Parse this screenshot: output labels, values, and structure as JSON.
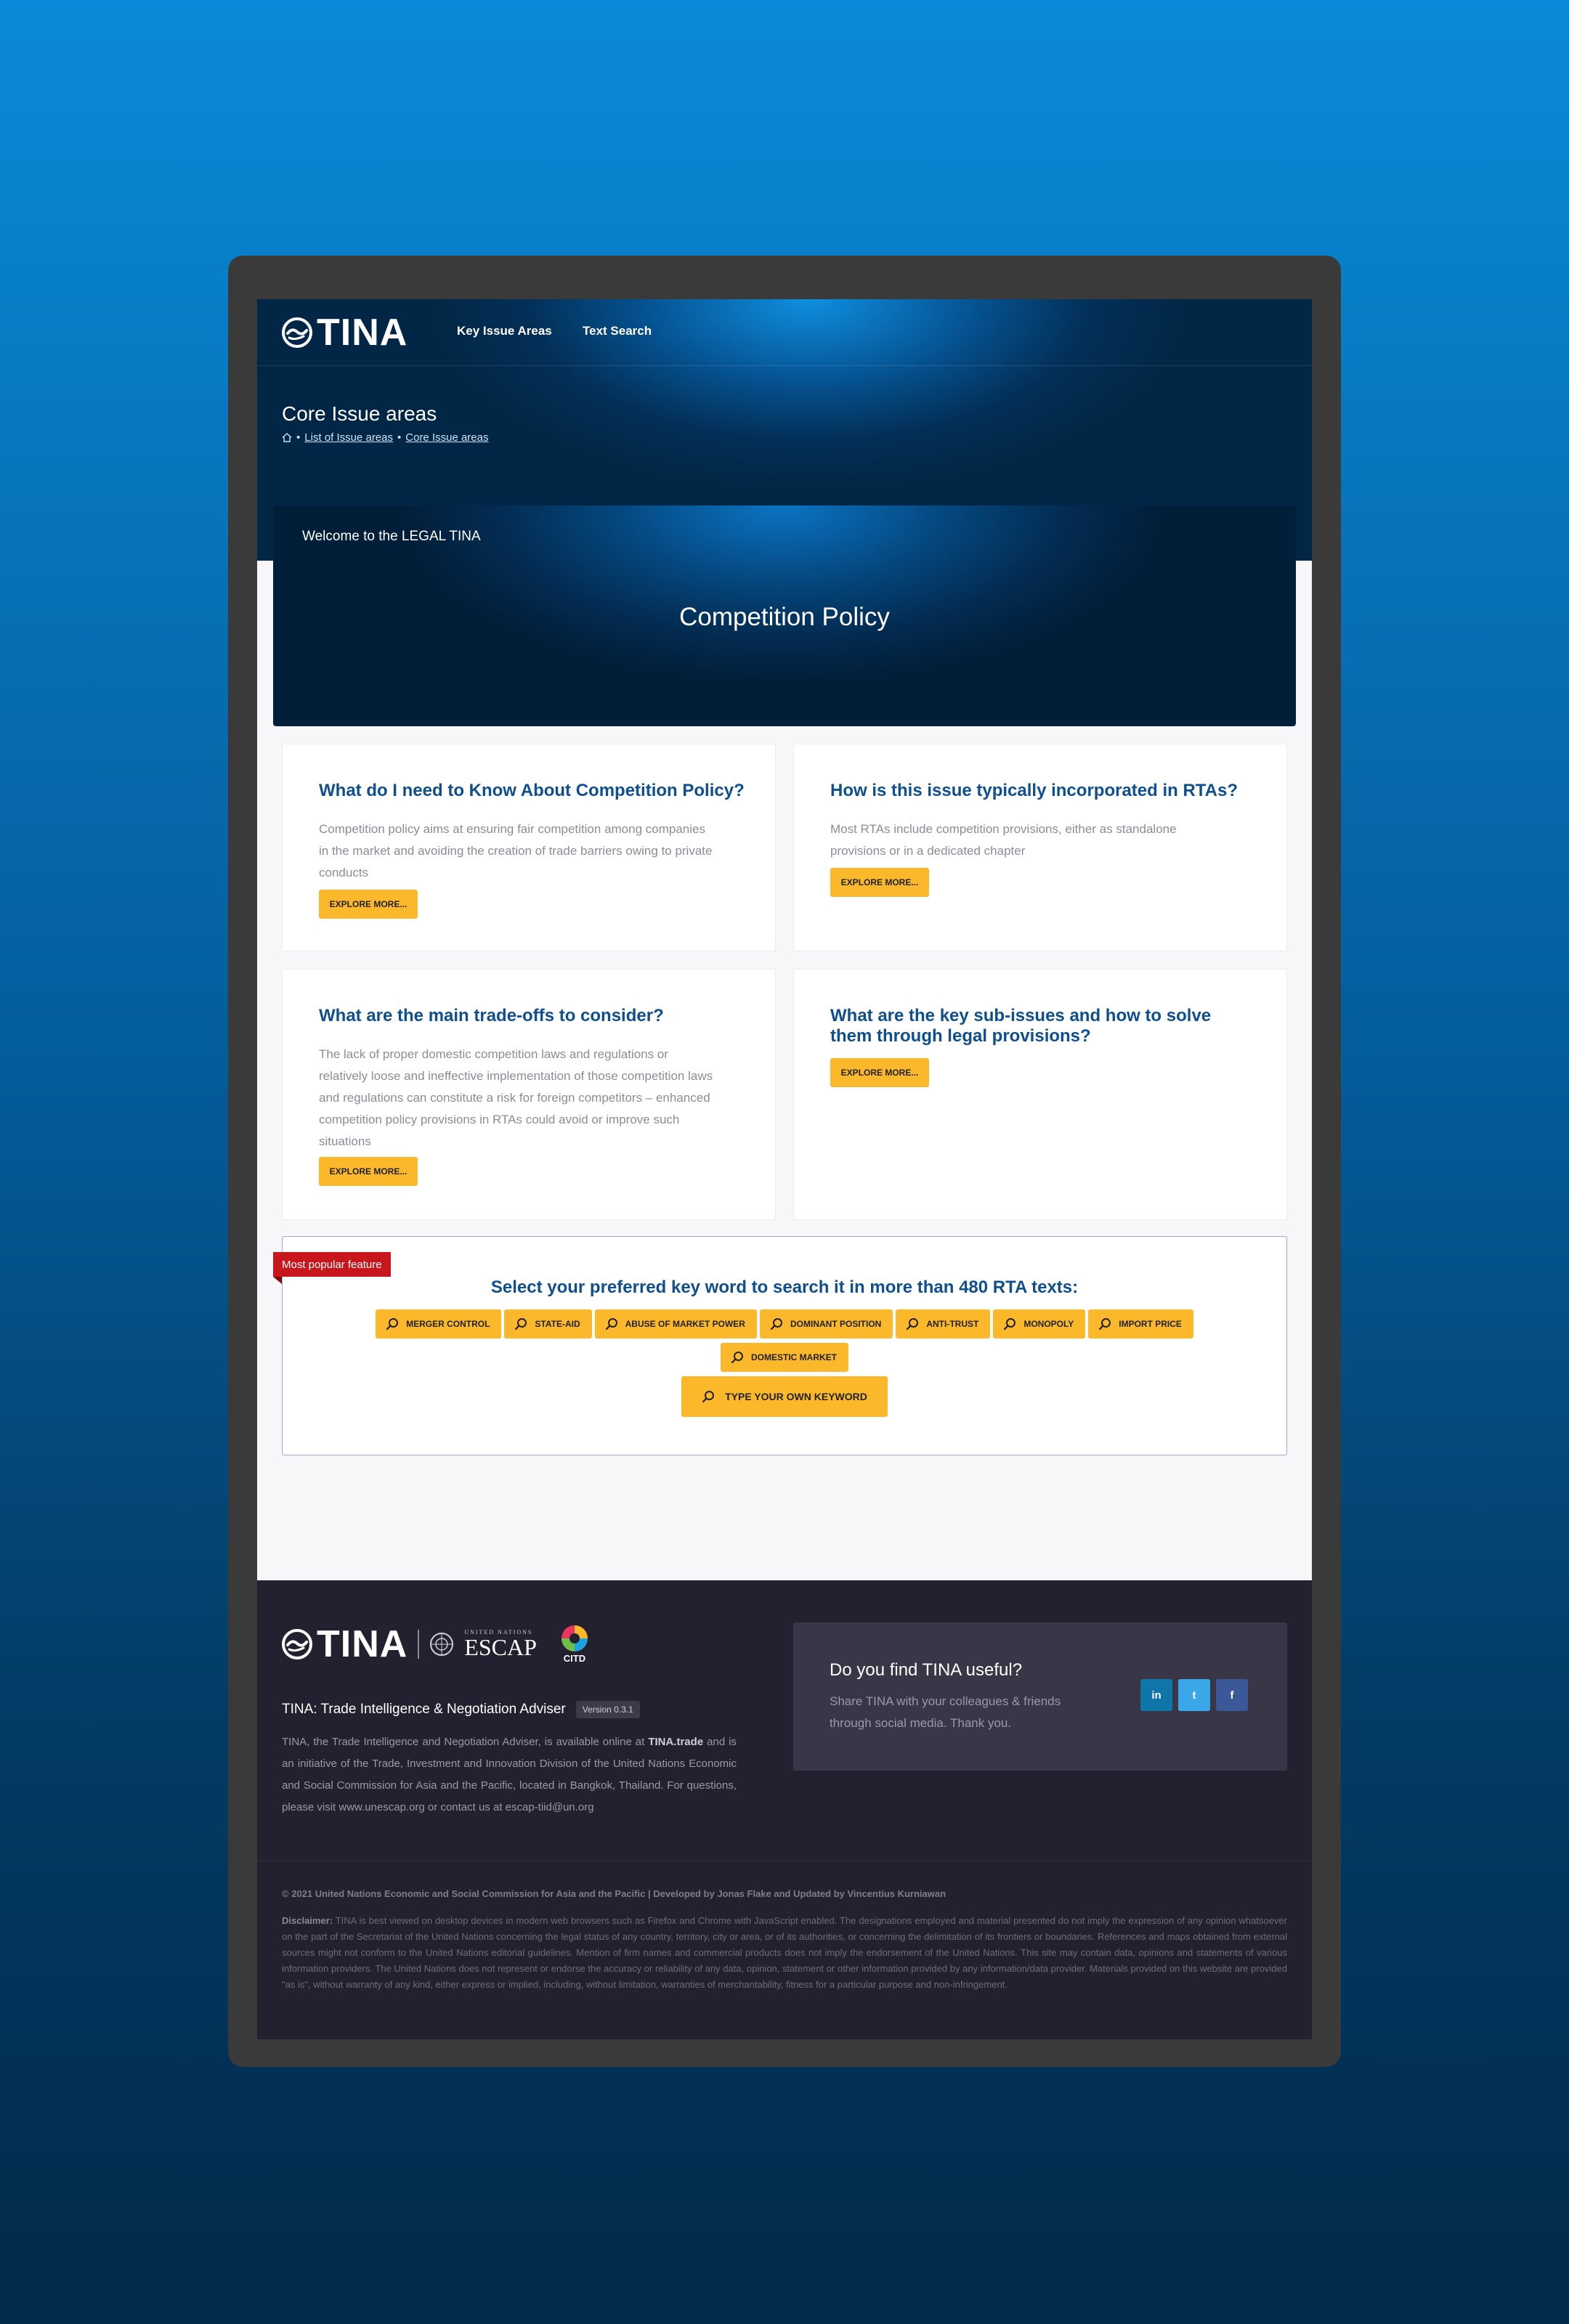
{
  "nav": {
    "logo": "TINA",
    "links": [
      "Key Issue Areas",
      "Text Search"
    ]
  },
  "header": {
    "title": "Core Issue areas",
    "breadcrumbs": [
      "List of Issue areas",
      "Core Issue areas"
    ]
  },
  "banner": {
    "welcome": "Welcome to the LEGAL TINA",
    "headline": "Competition Policy"
  },
  "cards": [
    {
      "title": "What do I need to Know About Competition Policy?",
      "body": "Competition policy aims at ensuring fair competition among companies in the market and avoiding the creation of trade barriers owing to private conducts",
      "button": "EXPLORE MORE..."
    },
    {
      "title": "How is this issue typically incorporated in RTAs?",
      "body": "Most RTAs include competition provisions, either as standalone provisions or in a dedicated chapter",
      "button": "EXPLORE MORE..."
    },
    {
      "title": "What are the main trade-offs to consider?",
      "body": "The lack of proper domestic competition laws and regulations or relatively loose and ineffective implementation of those competition laws and regulations can constitute a risk for foreign competitors – enhanced competition policy provisions in RTAs could avoid or improve such situations",
      "button": "EXPLORE MORE..."
    },
    {
      "title": "What are the key sub-issues and how to solve them through legal provisions?",
      "body": "",
      "button": "EXPLORE MORE..."
    }
  ],
  "keyword_search": {
    "ribbon": "Most popular feature",
    "title": "Select your preferred key word to search it in more than 480 RTA texts:",
    "keywords_row1": [
      "MERGER CONTROL",
      "STATE-AID",
      "ABUSE OF MARKET POWER",
      "DOMINANT POSITION",
      "ANTI-TRUST",
      "MONOPOLY",
      "IMPORT PRICE"
    ],
    "keywords_row2": [
      "DOMESTIC MARKET"
    ],
    "custom_button": "TYPE YOUR OWN KEYWORD",
    "chip_color": "#fbb82b"
  },
  "footer": {
    "logo": "TINA",
    "partner_logos": [
      "UNITED NATIONS",
      "ESCAP",
      "CITD"
    ],
    "tagline": "TINA: Trade Intelligence & Negotiation Adviser",
    "version": "Version 0.3.1",
    "about_pre": "TINA, the Trade Intelligence and Negotiation Adviser, is available online at ",
    "about_link": "TINA.trade",
    "about_post": " and is an initiative of the Trade, Investment and Innovation Division of the United Nations Economic and Social Commission for Asia and the Pacific, located in Bangkok, Thailand. For questions, please visit www.unescap.org or contact us at escap-tiid@un.org",
    "share_title": "Do you find TINA useful?",
    "share_text": "Share TINA with your colleagues & friends through social media. Thank you.",
    "social": [
      {
        "name": "linkedin-icon",
        "glyph": "in",
        "color": "#0e76a8"
      },
      {
        "name": "twitter-icon",
        "glyph": "t",
        "color": "#3aa8e8"
      },
      {
        "name": "facebook-icon",
        "glyph": "f",
        "color": "#3b5998"
      }
    ],
    "copyright": "© 2021 United Nations Economic and Social Commission for Asia and the Pacific | Developed by Jonas Flake and Updated by Vincentius Kurniawan",
    "disclaimer_label": "Disclaimer:",
    "disclaimer": " TINA is best viewed on desktop devices in modern web browsers such as Firefox and Chrome with JavaScript enabled. The designations employed and material presented do not imply the expression of any opinion whatsoever on the part of the Secretariat of the United Nations concerning the legal status of any country, territory, city or area, or of its authorities, or concerning the delimitation of its frontiers or boundaries. References and maps obtained from external sources might not conform to the United Nations editorial guidelines. Mention of firm names and commercial products does not imply the endorsement of the United Nations. This site may contain data, opinions and statements of various information providers. The United Nations does not represent or endorse the accuracy or reliability of any data, opinion, statement or other information provided by any information/data provider. Materials provided on this website are provided \"as is\", without warranty of any kind, either express or implied, including, without limitation, warranties of merchantability, fitness for a particular purpose and non-infringement."
  },
  "colors": {
    "accent": "#fbb82b",
    "title_blue": "#0e4f8f",
    "ribbon_red": "#c8161d",
    "footer_bg": "#23212f"
  }
}
